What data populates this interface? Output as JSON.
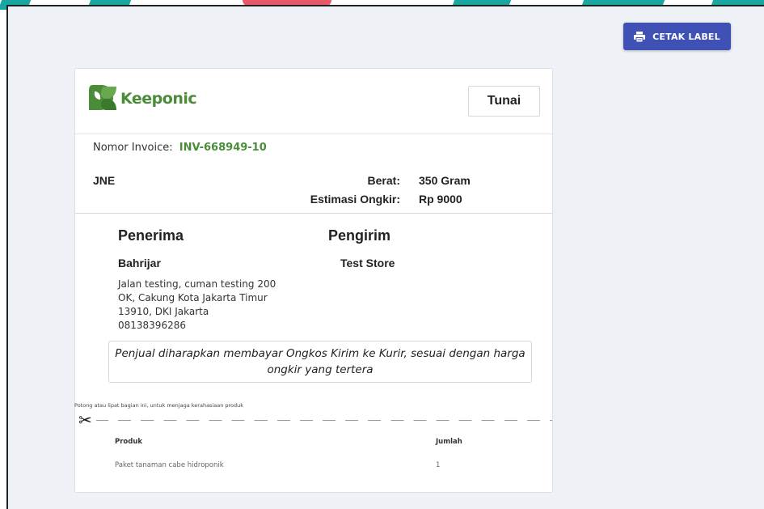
{
  "toolbar": {
    "print_label": "CETAK LABEL"
  },
  "header": {
    "brand": "Keeponic",
    "payment_method": "Tunai"
  },
  "invoice": {
    "label": "Nomor Invoice:",
    "number": "INV-668949-10"
  },
  "shipping": {
    "courier": "JNE",
    "weight_label": "Berat:",
    "weight_value": "350 Gram",
    "cost_label": "Estimasi Ongkir:",
    "cost_value": "Rp 9000"
  },
  "recipient": {
    "title": "Penerima",
    "name": "Bahrijar",
    "address_lines": [
      "Jalan testing, cuman testing 200",
      "OK, Cakung Kota Jakarta Timur",
      "13910, DKI Jakarta",
      "08138396286"
    ]
  },
  "sender": {
    "title": "Pengirim",
    "name": "Test Store"
  },
  "note": "Penjual diharapkan membayar Ongkos Kirim ke Kurir, sesuai dengan harga ongkir yang tertera",
  "cut_instruction": "Potong atau lipat bagian ini, untuk menjaga kerahasiaan produk",
  "products": {
    "headers": {
      "product": "Produk",
      "qty": "Jumlah"
    },
    "rows": [
      {
        "product": "Paket tanaman cabe hidroponik",
        "qty": "1"
      }
    ]
  },
  "colors": {
    "accent": "#3f51b5",
    "brand_green": "#4b8c3a",
    "background": "#eef1f6"
  },
  "icons": {
    "print": "printer-icon",
    "cut": "scissors-icon",
    "logo": "keeponic-leaf-logo-icon"
  }
}
